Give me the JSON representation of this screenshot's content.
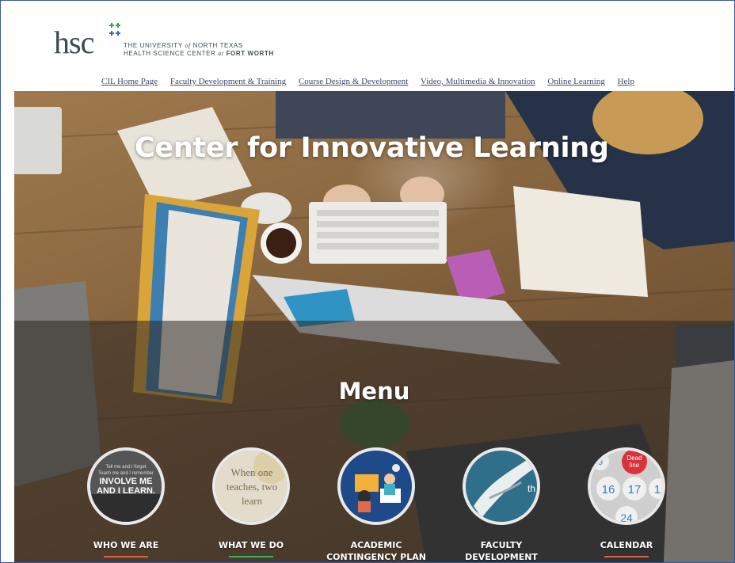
{
  "header": {
    "logo_mark": "hsc",
    "logo_line1_a": "THE UNIVERSITY",
    "logo_line1_of": "of",
    "logo_line1_b": "NORTH TEXAS",
    "logo_line2_a": "HEALTH SCIENCE CENTER",
    "logo_line2_at": "at",
    "logo_line2_b": "FORT WORTH"
  },
  "nav": {
    "items": [
      {
        "label": "CIL Home Page"
      },
      {
        "label": "Faculty Development & Training"
      },
      {
        "label": "Course Design & Development"
      },
      {
        "label": "Video, Multimedia & Innovation"
      },
      {
        "label": "Online Learning"
      },
      {
        "label": "Help"
      }
    ]
  },
  "hero": {
    "title": "Center for Innovative Learning"
  },
  "menu": {
    "title": "Menu",
    "items": [
      {
        "label": "WHO WE ARE",
        "label2": "",
        "underline_color": "#e0604a",
        "image_text": [
          "Tell me and I forget",
          "Teach me and I remember",
          "INVOLVE ME",
          "AND I LEARN."
        ]
      },
      {
        "label": "WHAT WE DO",
        "label2": "",
        "underline_color": "#3fae5a",
        "image_text": [
          "When one",
          "teaches, two",
          "learn"
        ]
      },
      {
        "label": "ACADEMIC",
        "label2": "CONTINGENCY PLAN",
        "underline_color": "#e0604a",
        "image_text": []
      },
      {
        "label": "FACULTY",
        "label2": "DEVELOPMENT",
        "underline_color": "#e0604a",
        "image_text": [
          "th"
        ]
      },
      {
        "label": "CALENDAR",
        "label2": "",
        "underline_color": "#e0604a",
        "image_text": [
          "Dead",
          "line",
          "9",
          "16",
          "17",
          "1",
          "24"
        ]
      }
    ]
  },
  "colors": {
    "nav_link": "#3c4a6a",
    "logo_star": "#2aa84a",
    "logo_star_blue": "#2b6fb6",
    "frame_border": "#3a5a9a"
  }
}
